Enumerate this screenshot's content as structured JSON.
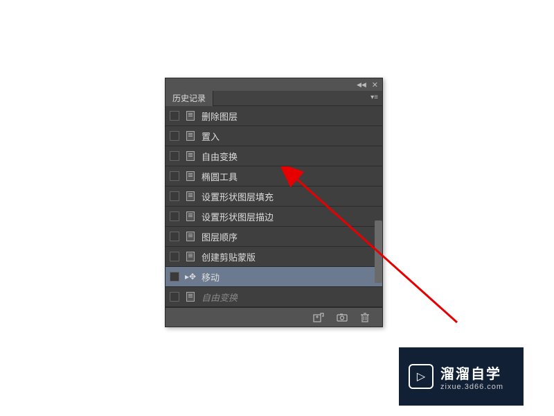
{
  "panel": {
    "tab_label": "历史记录",
    "rows": [
      {
        "label": "删除图层",
        "icon": "doc",
        "selected": false,
        "dimmed": false
      },
      {
        "label": "置入",
        "icon": "doc",
        "selected": false,
        "dimmed": false
      },
      {
        "label": "自由变换",
        "icon": "doc",
        "selected": false,
        "dimmed": false
      },
      {
        "label": "椭圆工具",
        "icon": "doc",
        "selected": false,
        "dimmed": false
      },
      {
        "label": "设置形状图层填充",
        "icon": "doc",
        "selected": false,
        "dimmed": false
      },
      {
        "label": "设置形状图层描边",
        "icon": "doc",
        "selected": false,
        "dimmed": false
      },
      {
        "label": "图层顺序",
        "icon": "doc",
        "selected": false,
        "dimmed": false
      },
      {
        "label": "创建剪贴蒙版",
        "icon": "doc",
        "selected": false,
        "dimmed": false
      },
      {
        "label": "移动",
        "icon": "move",
        "selected": true,
        "dimmed": false
      },
      {
        "label": "自由变换",
        "icon": "doc",
        "selected": false,
        "dimmed": true
      }
    ]
  },
  "watermark": {
    "title": "溜溜自学",
    "sub": "zixue.3d66.com"
  },
  "colors": {
    "arrow": "#e60000",
    "panel_bg": "#535353",
    "selected_bg": "#6b7a8f"
  }
}
